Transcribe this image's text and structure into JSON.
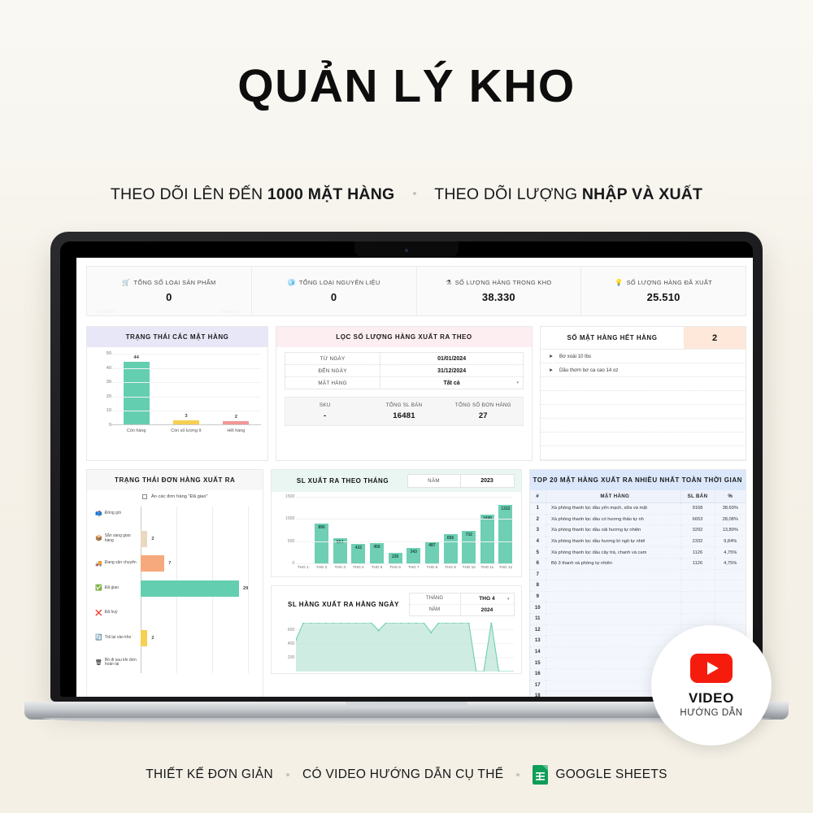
{
  "headline": "QUẢN LÝ KHO",
  "subheadline": {
    "left_plain": "THEO DÕI LÊN ĐẾN ",
    "left_bold": "1000 MẶT HÀNG",
    "right_plain": "THEO DÕI LƯỢNG ",
    "right_bold": "NHẬP VÀ XUẤT"
  },
  "kpis": [
    {
      "icon": "cart-icon",
      "glyph": "🛒",
      "label": "TỔNG SỐ LOẠI SẢN PHẨM",
      "value": "0",
      "ghost_left": "Income",
      "ghost_right": "Expense"
    },
    {
      "icon": "boxes-icon",
      "glyph": "🧊",
      "label": "TỔNG LOẠI NGUYÊN LIỆU",
      "value": "0",
      "ghost_left": "",
      "ghost_right": ""
    },
    {
      "icon": "inbox-icon",
      "glyph": "⚗",
      "label": "SỐ LƯỢNG HÀNG TRONG KHO",
      "value": "38.330",
      "ghost_left": "",
      "ghost_right": ""
    },
    {
      "icon": "bulb-icon",
      "glyph": "💡",
      "label": "SỐ LƯỢNG HÀNG ĐÃ XUẤT",
      "value": "25.510",
      "ghost_left": "",
      "ghost_right": ""
    }
  ],
  "item_status_chart": {
    "title": "TRẠNG THÁI CÁC MẶT HÀNG",
    "chart": {
      "type": "bar",
      "title": "TRẠNG THÁI CÁC MẶT HÀNG",
      "categories": [
        "Còn hàng",
        "Còn số lượng ít",
        "Hết hàng"
      ],
      "values": [
        44,
        3,
        2
      ],
      "colors": [
        "#63cfb0",
        "#f6cf53",
        "#f39698"
      ],
      "yticks": [
        0,
        10,
        20,
        30,
        40,
        50
      ],
      "ylim": [
        0,
        50
      ],
      "xlabel": "",
      "ylabel": ""
    }
  },
  "filter_panel": {
    "title": "LỌC SỐ LƯỢNG HÀNG XUẤT RA THEO",
    "rows": [
      {
        "key": "TỪ NGÀY",
        "value": "01/01/2024",
        "has_caret": false
      },
      {
        "key": "ĐẾN NGÀY",
        "value": "31/12/2024",
        "has_caret": false
      },
      {
        "key": "MẶT HÀNG",
        "value": "Tất cả",
        "has_caret": true
      }
    ],
    "totals": [
      {
        "label": "SKU",
        "value": "-"
      },
      {
        "label": "TỔNG SL BÁN",
        "value": "16481"
      },
      {
        "label": "TỔNG SỐ ĐƠN HÀNG",
        "value": "27"
      }
    ]
  },
  "out_of_stock": {
    "title": "SỐ MẶT HÀNG HẾT HÀNG",
    "count": "2",
    "items": [
      "Bơ xoài 10 lbs",
      "Dầu thơm bơ ca cao 14 oz"
    ],
    "empty_rows": 6
  },
  "order_status_chart": {
    "title": "TRẠNG THÁI ĐƠN HÀNG XUẤT RA",
    "checkbox_label": "Ẩn các đơn hàng \"Đã giao\"",
    "chart": {
      "type": "bar",
      "orientation": "horizontal",
      "title": "TRẠNG THÁI ĐƠN HÀNG XUẤT RA",
      "categories": [
        "Đóng gói",
        "Sẵn sàng giao hàng",
        "Đang vận chuyển",
        "Đã giao",
        "Đã huỷ",
        "Trả lại vào kho",
        "Bỏ đi sau khi đơn hoàn lại"
      ],
      "values": [
        0,
        2,
        7,
        29,
        0,
        2,
        0
      ],
      "emojis": [
        "📫",
        "📦",
        "🚚",
        "✅",
        "❌",
        "🔄",
        "🗑"
      ],
      "colors": [
        "#9fd2ee",
        "#ead9bf",
        "#f6a97c",
        "#63cfb0",
        "#e86a5a",
        "#f6cf53",
        "#bdbdbd"
      ],
      "xlim": [
        0,
        35
      ]
    }
  },
  "monthly_chart": {
    "title": "SL XUẤT RA THEO THÁNG",
    "select": {
      "key": "NĂM",
      "value": "2023"
    },
    "chart": {
      "type": "bar",
      "title": "SL XUẤT RA THEO THÁNG",
      "categories": [
        "THG 1",
        "THG 2",
        "THG 3",
        "THG 4",
        "THG 5",
        "THG 6",
        "THG 7",
        "THG 8",
        "THG 9",
        "THG 10",
        "THG 11",
        "THG 12"
      ],
      "values": [
        0,
        890,
        564,
        432,
        456,
        235,
        343,
        487,
        656,
        732,
        1099,
        1322
      ],
      "yticks": [
        0,
        500,
        1000,
        1500
      ],
      "ylim": [
        0,
        1500
      ],
      "color": "#6ecfb4"
    }
  },
  "daily_chart": {
    "title": "SL HÀNG XUẤT RA HẰNG NGÀY",
    "selects": [
      {
        "key": "THÁNG",
        "value": "THG 4",
        "has_caret": true
      },
      {
        "key": "NĂM",
        "value": "2024",
        "has_caret": false
      }
    ],
    "chart": {
      "type": "area",
      "title": "SL HÀNG XUẤT RA HẰNG NGÀY",
      "yticks": [
        200,
        400,
        600
      ],
      "ylim": [
        0,
        700
      ],
      "color": "#6ecfb4",
      "values": [
        455,
        700,
        700,
        700,
        700,
        700,
        700,
        700,
        700,
        700,
        700,
        590,
        700,
        700,
        700,
        700,
        700,
        700,
        560,
        700,
        700,
        700,
        700,
        700,
        0,
        0,
        700,
        0,
        0,
        0
      ]
    }
  },
  "top20": {
    "title": "TOP 20 MẶT HÀNG XUẤT RA NHIỀU NHẤT TOÀN THỜI GIAN",
    "columns": [
      "#",
      "MẶT HÀNG",
      "SL BÁN",
      "%"
    ],
    "rows": [
      {
        "idx": "1",
        "name": "Xà phòng thanh lọc dầu yến mạch, sữa và mật",
        "sl": "9168",
        "pct": "38,69%"
      },
      {
        "idx": "2",
        "name": "Xà phòng thanh lọc dầu có hương thảo tự nh",
        "sl": "6653",
        "pct": "28,08%"
      },
      {
        "idx": "3",
        "name": "Xà phòng thanh lọc dầu oải hương tự nhiên",
        "sl": "3292",
        "pct": "13,89%"
      },
      {
        "idx": "4",
        "name": "Xà phòng thanh lọc dầu hương bí ngô tự nhiê",
        "sl": "2332",
        "pct": "9,84%"
      },
      {
        "idx": "5",
        "name": "Xà phòng thanh lọc dầu cây trà, chanh và cam",
        "sl": "1126",
        "pct": "4,75%"
      },
      {
        "idx": "6",
        "name": "Bộ 3 thanh xà phòng tự nhiên",
        "sl": "1126",
        "pct": "4,75%"
      },
      {
        "idx": "7",
        "name": "",
        "sl": "",
        "pct": ""
      },
      {
        "idx": "8",
        "name": "",
        "sl": "",
        "pct": ""
      },
      {
        "idx": "9",
        "name": "",
        "sl": "",
        "pct": ""
      },
      {
        "idx": "10",
        "name": "",
        "sl": "",
        "pct": ""
      },
      {
        "idx": "11",
        "name": "",
        "sl": "",
        "pct": ""
      },
      {
        "idx": "12",
        "name": "",
        "sl": "",
        "pct": ""
      },
      {
        "idx": "13",
        "name": "",
        "sl": "",
        "pct": ""
      },
      {
        "idx": "14",
        "name": "",
        "sl": "",
        "pct": ""
      },
      {
        "idx": "15",
        "name": "",
        "sl": "",
        "pct": ""
      },
      {
        "idx": "16",
        "name": "",
        "sl": "",
        "pct": ""
      },
      {
        "idx": "17",
        "name": "",
        "sl": "",
        "pct": ""
      },
      {
        "idx": "18",
        "name": "",
        "sl": "",
        "pct": ""
      }
    ]
  },
  "video_badge": {
    "line1": "VIDEO",
    "line2": "HƯỚNG DẪN",
    "icon": "youtube-icon"
  },
  "footer": {
    "item1": "THIẾT KẾ ĐƠN GIẢN",
    "item2": "CÓ VIDEO HƯỚNG DẪN CỤ THỂ",
    "item3": "GOOGLE SHEETS",
    "icon": "google-sheets-icon"
  },
  "colors": {
    "background": "#f7f4ed",
    "mint": "#63cfb0",
    "yellow": "#f6cf53",
    "pink": "#f39698",
    "orange": "#f6a97c",
    "youtube_red": "#f61c0d",
    "sheets_green": "#0f9d58"
  }
}
